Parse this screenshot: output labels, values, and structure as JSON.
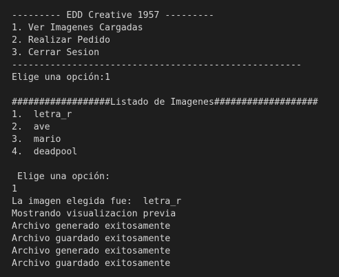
{
  "terminal": {
    "lines": [
      "--------- EDD Creative 1957 ---------",
      "1. Ver Imagenes Cargadas",
      "2. Realizar Pedido",
      "3. Cerrar Sesion",
      "-----------------------------------------------------",
      "Elige una opción:1",
      "",
      "##################Listado de Imagenes###################",
      "1.  letra_r",
      "2.  ave",
      "3.  mario",
      "4.  deadpool",
      "",
      " Elige una opción:",
      "1",
      "La imagen elegida fue:  letra_r",
      "Mostrando visualizacion previa",
      "Archivo generado exitosamente",
      "Archivo guardado exitosamente",
      "Archivo generado exitosamente",
      "Archivo guardado exitosamente"
    ]
  },
  "colors": {
    "background": "#1e1e1e",
    "text": "#d4d4d4"
  }
}
